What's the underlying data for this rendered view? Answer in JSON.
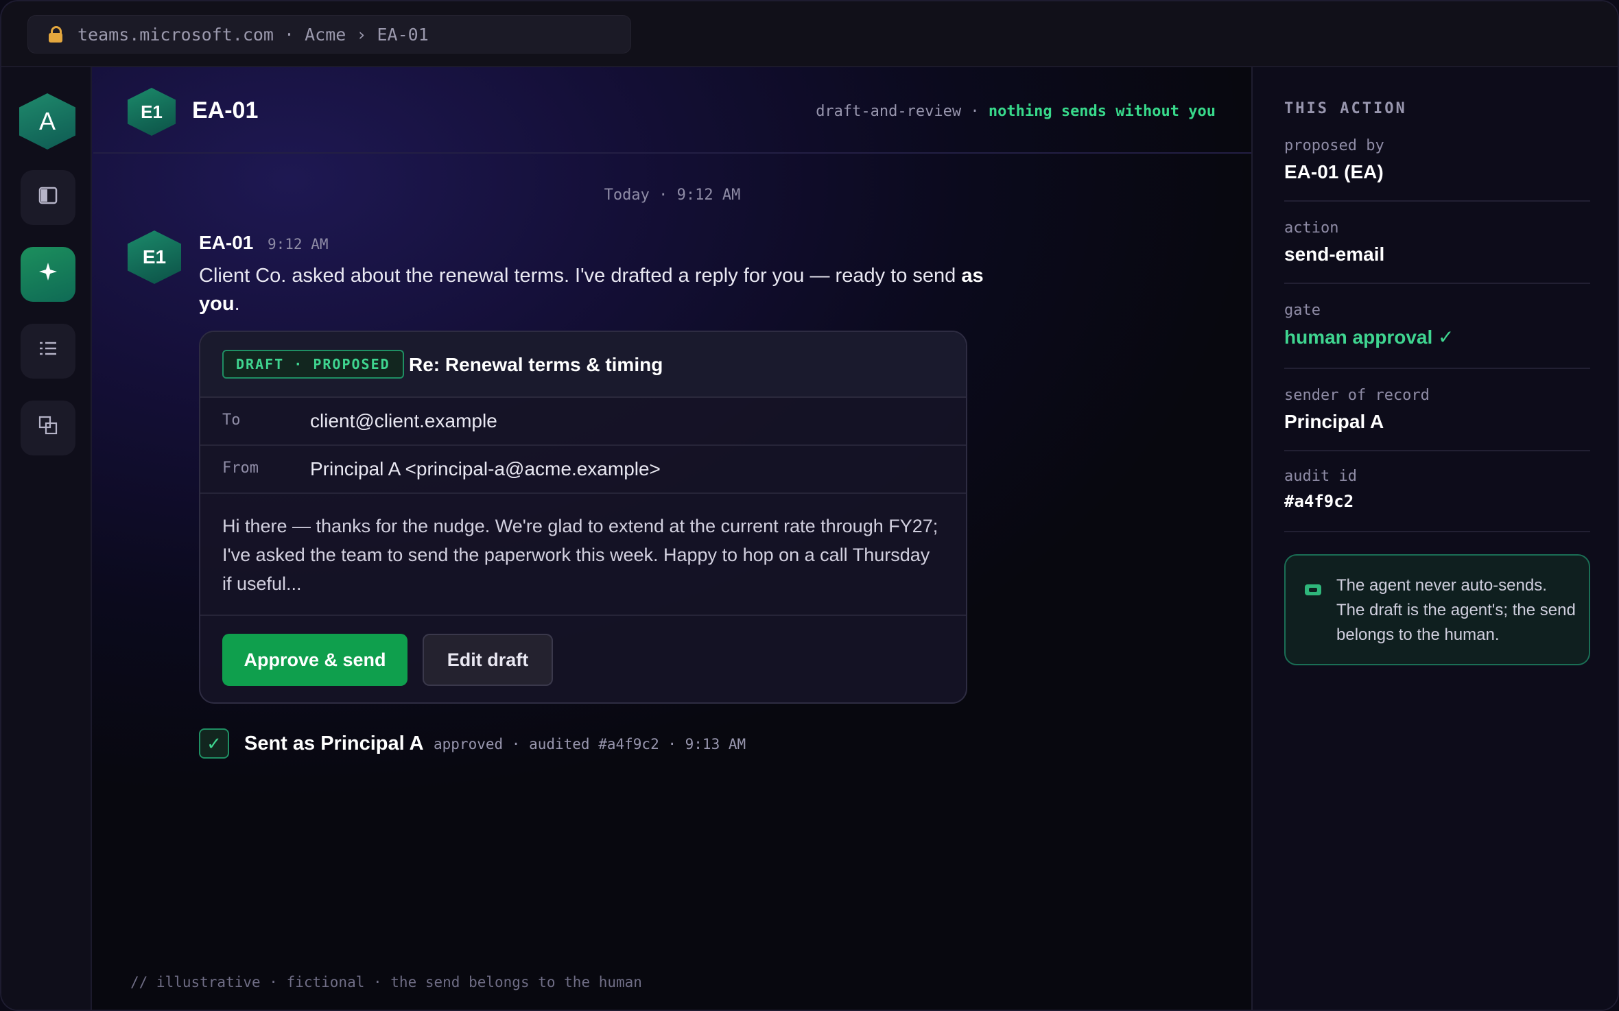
{
  "browser": {
    "url": "teams.microsoft.com · Acme › EA-01"
  },
  "rail": {
    "avatar_letter": "A",
    "icons": [
      "panel-icon",
      "sparkle-icon",
      "list-icon",
      "copy-icon"
    ]
  },
  "header": {
    "avatar_initials": "E1",
    "title": "EA-01",
    "mode": "draft-and-review",
    "separator": " · ",
    "policy": "nothing sends without you"
  },
  "conversation": {
    "day_separator": "Today · 9:12 AM",
    "message": {
      "avatar_initials": "E1",
      "author": "EA-01",
      "time": "9:12 AM",
      "text_before": "Client Co. asked about the renewal terms. I've drafted a reply for you — ready to send ",
      "text_bold": "as you",
      "text_after": "."
    },
    "draft": {
      "badge": "DRAFT · PROPOSED",
      "subject": "Re: Renewal terms & timing",
      "to_label": "To",
      "to_value": "client@client.example",
      "from_label": "From",
      "from_value": "Principal A <principal-a@acme.example>",
      "body": "Hi there — thanks for the nudge. We're glad to extend at the current rate through FY27; I've asked the team to send the paperwork this week. Happy to hop on a call Thursday if useful...",
      "approve_label": "Approve & send",
      "edit_label": "Edit draft"
    },
    "sent": {
      "check": "✓",
      "title": "Sent as Principal A",
      "meta": "approved · audited #a4f9c2 · 9:13 AM"
    },
    "footnote": "// illustrative · fictional · the send belongs to the human"
  },
  "side": {
    "title": "THIS ACTION",
    "props": [
      {
        "key": "proposed by",
        "value": "EA-01 (EA)"
      },
      {
        "key": "action",
        "value": "send-email"
      },
      {
        "key": "gate",
        "value": "human approval ✓"
      },
      {
        "key": "sender of record",
        "value": "Principal A"
      },
      {
        "key": "audit id",
        "value": "#a4f9c2"
      }
    ],
    "note": "The agent never auto-sends. The draft is the agent's; the send belongs to the human."
  },
  "colors": {
    "accent_green": "#3fd590",
    "approve_button": "#0f9f4d",
    "background": "#140f37"
  }
}
